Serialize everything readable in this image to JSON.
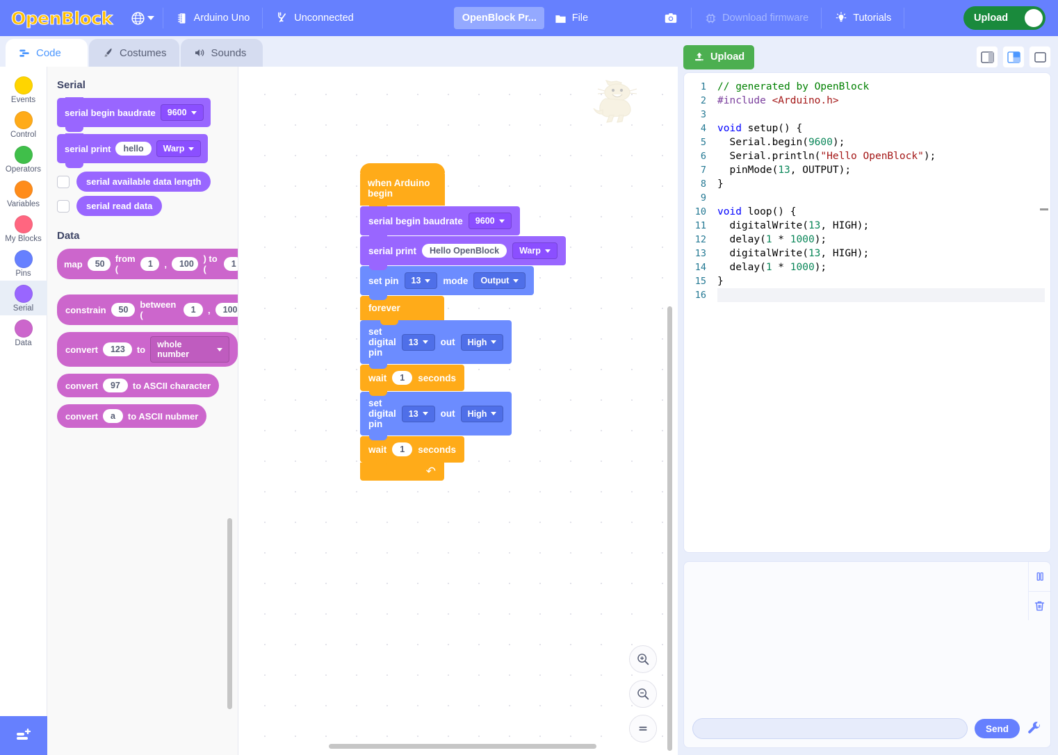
{
  "menubar": {
    "logo": "OpenBlock",
    "language_icon": "globe-icon",
    "board": "Arduino Uno",
    "connection": "Unconnected",
    "project_name": "OpenBlock Pr...",
    "file_menu": "File",
    "screenshot_icon": "camera-icon",
    "download_firmware": "Download firmware",
    "tutorials": "Tutorials",
    "upload_toggle": "Upload"
  },
  "tabs": [
    {
      "label": "Code",
      "icon": "code-icon",
      "active": true
    },
    {
      "label": "Costumes",
      "icon": "brush-icon",
      "active": false
    },
    {
      "label": "Sounds",
      "icon": "speaker-icon",
      "active": false
    }
  ],
  "categories": [
    {
      "label": "Events",
      "color": "#ffd500",
      "selected": false
    },
    {
      "label": "Control",
      "color": "#ffab19",
      "selected": false
    },
    {
      "label": "Operators",
      "color": "#40bf4a",
      "selected": false
    },
    {
      "label": "Variables",
      "color": "#ff8c1a",
      "selected": false
    },
    {
      "label": "My Blocks",
      "color": "#ff6680",
      "selected": false
    },
    {
      "label": "Pins",
      "color": "#6680ff",
      "selected": false
    },
    {
      "label": "Serial",
      "color": "#9966ff",
      "selected": true
    },
    {
      "label": "Data",
      "color": "#cc66cc",
      "selected": false
    }
  ],
  "palette": {
    "sections": [
      {
        "title": "Serial",
        "blocks": [
          {
            "kind": "stack",
            "parts": [
              {
                "t": "label",
                "v": "serial begin baudrate"
              },
              {
                "t": "dropdown",
                "v": "9600"
              }
            ]
          },
          {
            "kind": "stack",
            "parts": [
              {
                "t": "label",
                "v": "serial print"
              },
              {
                "t": "text",
                "v": "hello"
              },
              {
                "t": "dropdown",
                "v": "Warp"
              }
            ]
          },
          {
            "kind": "report",
            "checkbox": true,
            "parts": [
              {
                "t": "label",
                "v": "serial available data length"
              }
            ]
          },
          {
            "kind": "report",
            "checkbox": true,
            "parts": [
              {
                "t": "label",
                "v": "serial read data"
              }
            ]
          }
        ]
      },
      {
        "title": "Data",
        "blocks": [
          {
            "kind": "report",
            "parts": [
              {
                "t": "label",
                "v": "map"
              },
              {
                "t": "num",
                "v": "50"
              },
              {
                "t": "label",
                "v": "from ("
              },
              {
                "t": "num",
                "v": "1"
              },
              {
                "t": "label",
                "v": ","
              },
              {
                "t": "num",
                "v": "100"
              },
              {
                "t": "label",
                "v": ") to ("
              },
              {
                "t": "num",
                "v": "1"
              }
            ]
          },
          {
            "kind": "report",
            "parts": [
              {
                "t": "label",
                "v": "constrain"
              },
              {
                "t": "num",
                "v": "50"
              },
              {
                "t": "label",
                "v": "between ("
              },
              {
                "t": "num",
                "v": "1"
              },
              {
                "t": "label",
                "v": ","
              },
              {
                "t": "num",
                "v": "100"
              },
              {
                "t": "label",
                "v": ")"
              }
            ]
          },
          {
            "kind": "report",
            "parts": [
              {
                "t": "label",
                "v": "convert"
              },
              {
                "t": "num",
                "v": "123"
              },
              {
                "t": "label",
                "v": "to"
              },
              {
                "t": "dropdown",
                "v": "whole number"
              }
            ]
          },
          {
            "kind": "report",
            "parts": [
              {
                "t": "label",
                "v": "convert"
              },
              {
                "t": "num",
                "v": "97"
              },
              {
                "t": "label",
                "v": "to ASCII character"
              }
            ]
          },
          {
            "kind": "report",
            "parts": [
              {
                "t": "label",
                "v": "convert"
              },
              {
                "t": "text",
                "v": "a"
              },
              {
                "t": "label",
                "v": "to ASCII nubmer"
              }
            ]
          }
        ]
      }
    ]
  },
  "script": {
    "hat": "when Arduino begin",
    "serial_begin_label": "serial begin baudrate",
    "serial_begin_value": "9600",
    "serial_print_label": "serial print",
    "serial_print_value": "Hello OpenBlock",
    "serial_print_mode": "Warp",
    "set_pin_label": "set pin",
    "set_pin_value": "13",
    "set_pin_mode_label": "mode",
    "set_pin_mode_value": "Output",
    "forever": "forever",
    "set_digital_label": "set digital pin",
    "set_digital_pin1": "13",
    "out_label": "out",
    "out_value1": "High",
    "wait_label": "wait",
    "wait_value1": "1",
    "seconds_label": "seconds",
    "set_digital_pin2": "13",
    "out_value2": "High",
    "wait_value2": "1"
  },
  "workspace_controls": {
    "zoom_in": "zoom-in",
    "zoom_out": "zoom-out",
    "zoom_reset": "zoom-reset"
  },
  "right": {
    "upload_label": "Upload",
    "view_small": "layout-code-only",
    "view_split": "layout-split",
    "view_full": "layout-stage-only"
  },
  "code": {
    "lines": [
      {
        "n": "1",
        "tokens": [
          {
            "c": "c-com",
            "t": "// generated by OpenBlock"
          }
        ]
      },
      {
        "n": "2",
        "tokens": [
          {
            "c": "c-pre",
            "t": "#include "
          },
          {
            "c": "c-str",
            "t": "<Arduino.h>"
          }
        ]
      },
      {
        "n": "3",
        "tokens": []
      },
      {
        "n": "4",
        "tokens": [
          {
            "c": "c-kw",
            "t": "void"
          },
          {
            "c": "c-def",
            "t": " setup() {"
          }
        ]
      },
      {
        "n": "5",
        "tokens": [
          {
            "c": "c-def",
            "t": "  Serial.begin("
          },
          {
            "c": "c-num",
            "t": "9600"
          },
          {
            "c": "c-def",
            "t": ");"
          }
        ]
      },
      {
        "n": "6",
        "tokens": [
          {
            "c": "c-def",
            "t": "  Serial.println("
          },
          {
            "c": "c-str",
            "t": "\"Hello OpenBlock\""
          },
          {
            "c": "c-def",
            "t": ");"
          }
        ]
      },
      {
        "n": "7",
        "tokens": [
          {
            "c": "c-def",
            "t": "  pinMode("
          },
          {
            "c": "c-num",
            "t": "13"
          },
          {
            "c": "c-def",
            "t": ", OUTPUT);"
          }
        ]
      },
      {
        "n": "8",
        "tokens": [
          {
            "c": "c-def",
            "t": "}"
          }
        ]
      },
      {
        "n": "9",
        "tokens": []
      },
      {
        "n": "10",
        "tokens": [
          {
            "c": "c-kw",
            "t": "void"
          },
          {
            "c": "c-def",
            "t": " loop() {"
          }
        ]
      },
      {
        "n": "11",
        "tokens": [
          {
            "c": "c-def",
            "t": "  digitalWrite("
          },
          {
            "c": "c-num",
            "t": "13"
          },
          {
            "c": "c-def",
            "t": ", HIGH);"
          }
        ]
      },
      {
        "n": "12",
        "tokens": [
          {
            "c": "c-def",
            "t": "  delay("
          },
          {
            "c": "c-num",
            "t": "1"
          },
          {
            "c": "c-def",
            "t": " * "
          },
          {
            "c": "c-num",
            "t": "1000"
          },
          {
            "c": "c-def",
            "t": ");"
          }
        ]
      },
      {
        "n": "13",
        "tokens": [
          {
            "c": "c-def",
            "t": "  digitalWrite("
          },
          {
            "c": "c-num",
            "t": "13"
          },
          {
            "c": "c-def",
            "t": ", HIGH);"
          }
        ]
      },
      {
        "n": "14",
        "tokens": [
          {
            "c": "c-def",
            "t": "  delay("
          },
          {
            "c": "c-num",
            "t": "1"
          },
          {
            "c": "c-def",
            "t": " * "
          },
          {
            "c": "c-num",
            "t": "1000"
          },
          {
            "c": "c-def",
            "t": ");"
          }
        ]
      },
      {
        "n": "15",
        "tokens": [
          {
            "c": "c-def",
            "t": "}"
          }
        ]
      },
      {
        "n": "16",
        "tokens": [],
        "current": true
      }
    ]
  },
  "monitor": {
    "pause_icon": "pause-icon",
    "clear_icon": "trash-icon",
    "output": "",
    "input_value": "",
    "input_placeholder": "",
    "send_label": "Send",
    "settings_icon": "wrench-icon"
  },
  "colors": {
    "brand_blue": "#6680fe",
    "serial_purple": "#9966ff",
    "data_magenta": "#cc66cc",
    "pins_blue": "#6c8cff",
    "control_orange": "#ffab19",
    "upload_green": "#4caf50",
    "toggle_green": "#1a8a3c"
  }
}
